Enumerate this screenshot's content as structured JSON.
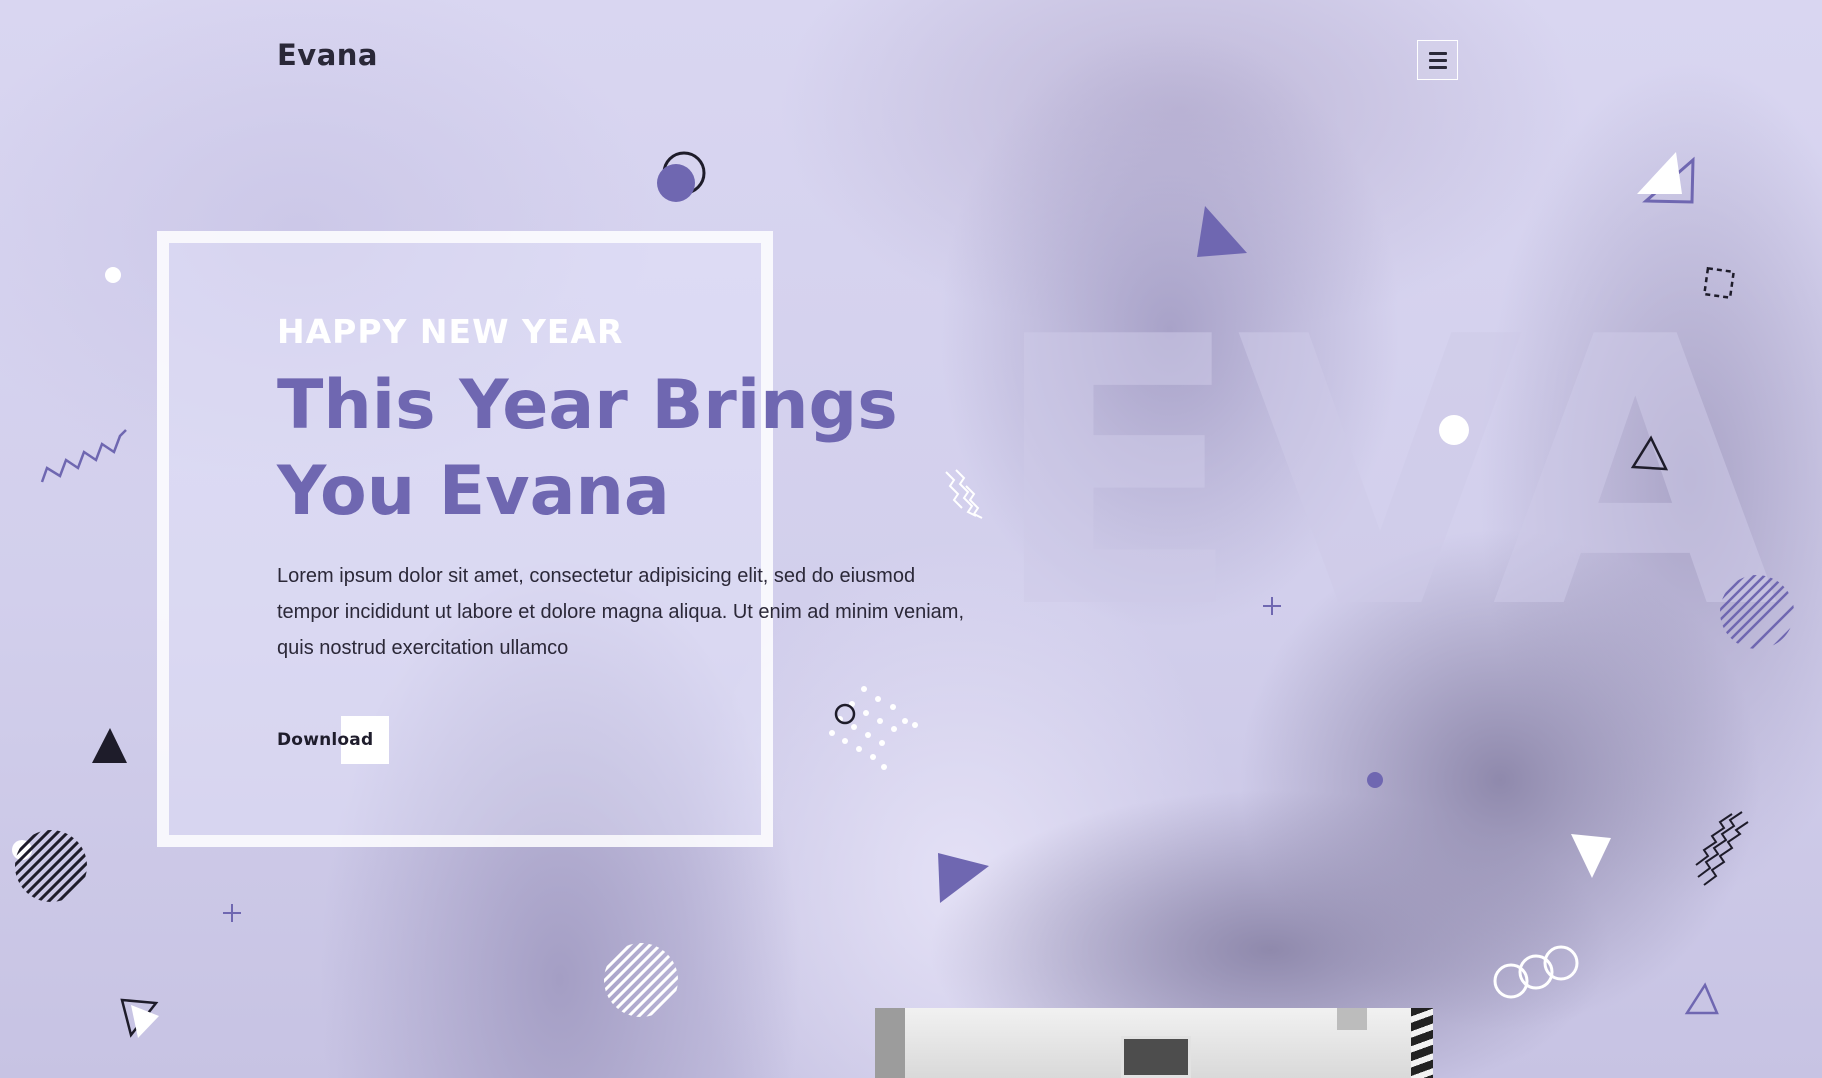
{
  "brand": {
    "logo_text": "Evana"
  },
  "header": {
    "menu_icon": "hamburger-menu-icon"
  },
  "hero": {
    "eyebrow": "HAPPY NEW YEAR",
    "headline_line1": "This Year Brings",
    "headline_line2": "You Evana",
    "body": "Lorem ipsum dolor sit amet, consectetur adipisicing elit, sed do eiusmod tempor incididunt ut labore et dolore magna aliqua. Ut enim ad minim veniam, quis nostrud exercitation ullamco",
    "cta_label": "Download",
    "watermark": "EVA"
  },
  "colors": {
    "accent": "#6f67b1",
    "overlay": "#d3d0ee",
    "text_dark": "#2b2838",
    "white": "#ffffff"
  }
}
